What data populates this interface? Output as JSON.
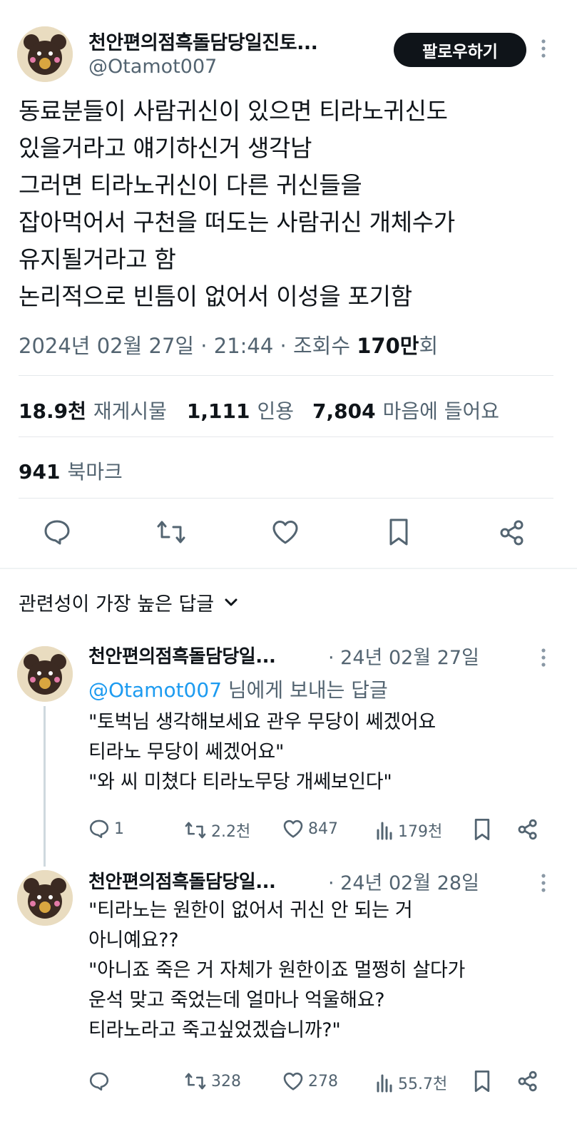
{
  "post": {
    "author_name": "천안편의점흑돌담당일진토...",
    "handle": "@Otamot007",
    "follow_label": "팔로우하기",
    "text": "동료분들이 사람귀신이 있으면 티라노귀신도\n있을거라고 얘기하신거 생각남\n그러면 티라노귀신이 다른 귀신들을\n잡아먹어서 구천을 떠도는 사람귀신 개체수가\n유지될거라고 함\n논리적으로 빈틈이 없어서 이성을 포기함",
    "timestamp": "2024년 02월 27일 · 21:44 · 조회수 ",
    "views_value": "170만",
    "views_suffix": "회",
    "stats": {
      "reposts_value": "18.9천",
      "reposts_label": "재게시물",
      "quotes_value": "1,111",
      "quotes_label": "인용",
      "likes_value": "7,804",
      "likes_label": "마음에 들어요"
    },
    "bookmarks_value": "941",
    "bookmarks_label": "북마크"
  },
  "sort_label": "관련성이 가장 높은 답글",
  "replies": [
    {
      "author_name": "천안편의점흑돌담당일...",
      "time": "· 24년 02월 27일",
      "reply_to_handle": "@Otamot007",
      "reply_to_suffix": " 님에게 보내는 답글",
      "text": "\"토벅님 생각해보세요 관우 무당이 쎄겠어요\n티라노 무당이 쎄겠어요\"\n\"와 씨 미쳤다 티라노무당 개쎄보인다\"",
      "replies": "1",
      "reposts": "2.2천",
      "likes": "847",
      "views": "179천"
    },
    {
      "author_name": "천안편의점흑돌담당일...",
      "time": "· 24년 02월 28일",
      "text": "\"티라노는 원한이 없어서 귀신 안 되는 거\n아니예요??\n\"아니죠 죽은 거 자체가 원한이죠 멀쩡히 살다가\n운석 맞고 죽었는데 얼마나 억울해요?\n티라노라고 죽고싶었겠습니까?\"",
      "replies": "",
      "reposts": "328",
      "likes": "278",
      "views": "55.7천"
    }
  ],
  "colors": {
    "text": "#0f1419",
    "secondary": "#536471",
    "link": "#1d9bf0",
    "divider": "#e5e8eb"
  },
  "icons": [
    "reply-icon",
    "repost-icon",
    "like-icon",
    "bookmark-icon",
    "share-icon",
    "views-icon",
    "more-icon",
    "chevron-down-icon"
  ]
}
